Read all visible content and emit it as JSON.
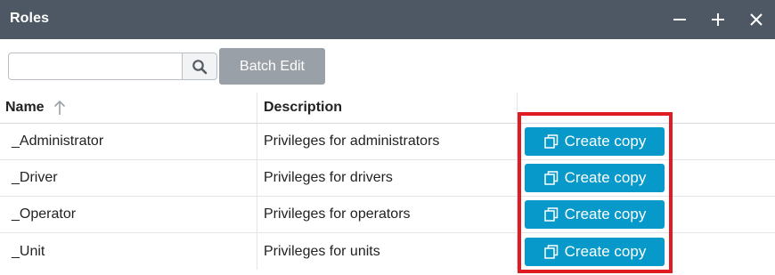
{
  "window": {
    "title": "Roles",
    "controls": [
      "minimize-icon",
      "maximize-icon",
      "close-icon"
    ]
  },
  "toolbar": {
    "search_value": "",
    "search_placeholder": "",
    "search_icon": "search-icon",
    "batch_edit_label": "Batch Edit"
  },
  "table": {
    "columns": {
      "name": "Name",
      "description": "Description",
      "actions": ""
    },
    "sort": {
      "column": "Name",
      "direction": "ascending",
      "icon": "arrow-up-icon"
    },
    "rows": [
      {
        "name": "_Administrator",
        "description": "Privileges for administrators",
        "action": "Create copy"
      },
      {
        "name": "_Driver",
        "description": "Privileges for drivers",
        "action": "Create copy"
      },
      {
        "name": "_Operator",
        "description": "Privileges for operators",
        "action": "Create copy"
      },
      {
        "name": "_Unit",
        "description": "Privileges for units",
        "action": "Create copy"
      }
    ]
  },
  "colors": {
    "titlebar": "#4e5864",
    "accent_button": "#0799c9",
    "disabled_button": "#9aa0a7",
    "highlight": "#e01b22"
  }
}
